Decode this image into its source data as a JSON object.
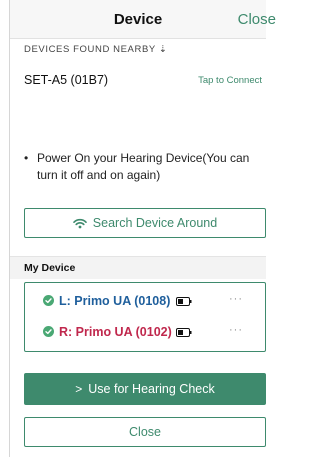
{
  "header": {
    "title": "Device",
    "close_label": "Close"
  },
  "nearby": {
    "caption": "DEVICES FOUND NEARBY ⇣",
    "devices": [
      {
        "name": "SET-A5 (01B7)",
        "action": "Tap to Connect"
      }
    ]
  },
  "instruction": {
    "bullet": "•",
    "text": "Power On your Hearing Device(You can turn it off and on again)"
  },
  "search_button": {
    "label": "Search Device Around",
    "icon": "wifi-icon"
  },
  "my_device": {
    "label": "My Device",
    "devices": [
      {
        "label": "L: Primo UA (0108)",
        "color": "#1f5f9c",
        "more": "···",
        "status_icon": "check-circle-icon",
        "battery_icon": "battery-icon"
      },
      {
        "label": "R: Primo UA (0102)",
        "color": "#c0284d",
        "more": "···",
        "status_icon": "check-circle-icon",
        "battery_icon": "battery-icon"
      }
    ]
  },
  "primary_button": {
    "label": "Use for Hearing Check",
    "chevron": ">"
  },
  "close_button": {
    "label": "Close"
  },
  "colors": {
    "accent": "#3e8a6d",
    "left_ear": "#1f5f9c",
    "right_ear": "#c0284d"
  }
}
